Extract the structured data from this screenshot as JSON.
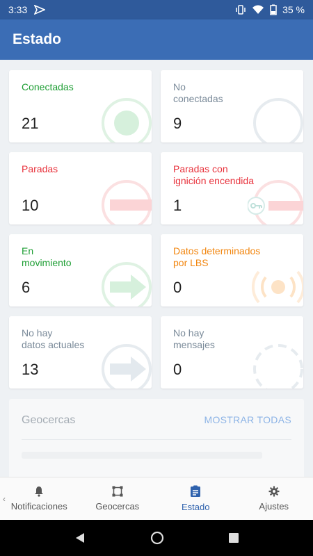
{
  "status_bar": {
    "time": "3:33",
    "battery": "35 %"
  },
  "app_bar": {
    "title": "Estado"
  },
  "cards": [
    {
      "label": "Conectadas",
      "count": "21",
      "color": "#1e9e34",
      "icon": "connected-circle-icon"
    },
    {
      "label": "No\nconectadas",
      "count": "9",
      "color": "#7a8a99",
      "icon": "disconnected-circle-icon"
    },
    {
      "label": "Paradas",
      "count": "10",
      "color": "#e8323c",
      "icon": "stopped-icon"
    },
    {
      "label": "Paradas con\nignición encendida",
      "count": "1",
      "color": "#e8323c",
      "icon": "key-icon"
    },
    {
      "label": "En\nmovimiento",
      "count": "6",
      "color": "#1e9e34",
      "icon": "moving-arrow-icon"
    },
    {
      "label": "Datos determinados\npor LBS",
      "count": "0",
      "color": "#f2860f",
      "icon": "lbs-signal-icon"
    },
    {
      "label": "No hay\ndatos actuales",
      "count": "13",
      "color": "#7a8a99",
      "icon": "no-data-arrow-icon"
    },
    {
      "label": "No hay\nmensajes",
      "count": "0",
      "color": "#7a8a99",
      "icon": "no-messages-dashed-icon"
    }
  ],
  "geofences": {
    "title": "Geocercas",
    "show_all": "MOSTRAR TODAS"
  },
  "bottom_nav": [
    {
      "label": "Notificaciones",
      "icon": "bell-icon"
    },
    {
      "label": "Geocercas",
      "icon": "geofence-square-icon"
    },
    {
      "label": "Estado",
      "icon": "clipboard-icon",
      "active": true
    },
    {
      "label": "Ajustes",
      "icon": "gear-icon"
    }
  ]
}
